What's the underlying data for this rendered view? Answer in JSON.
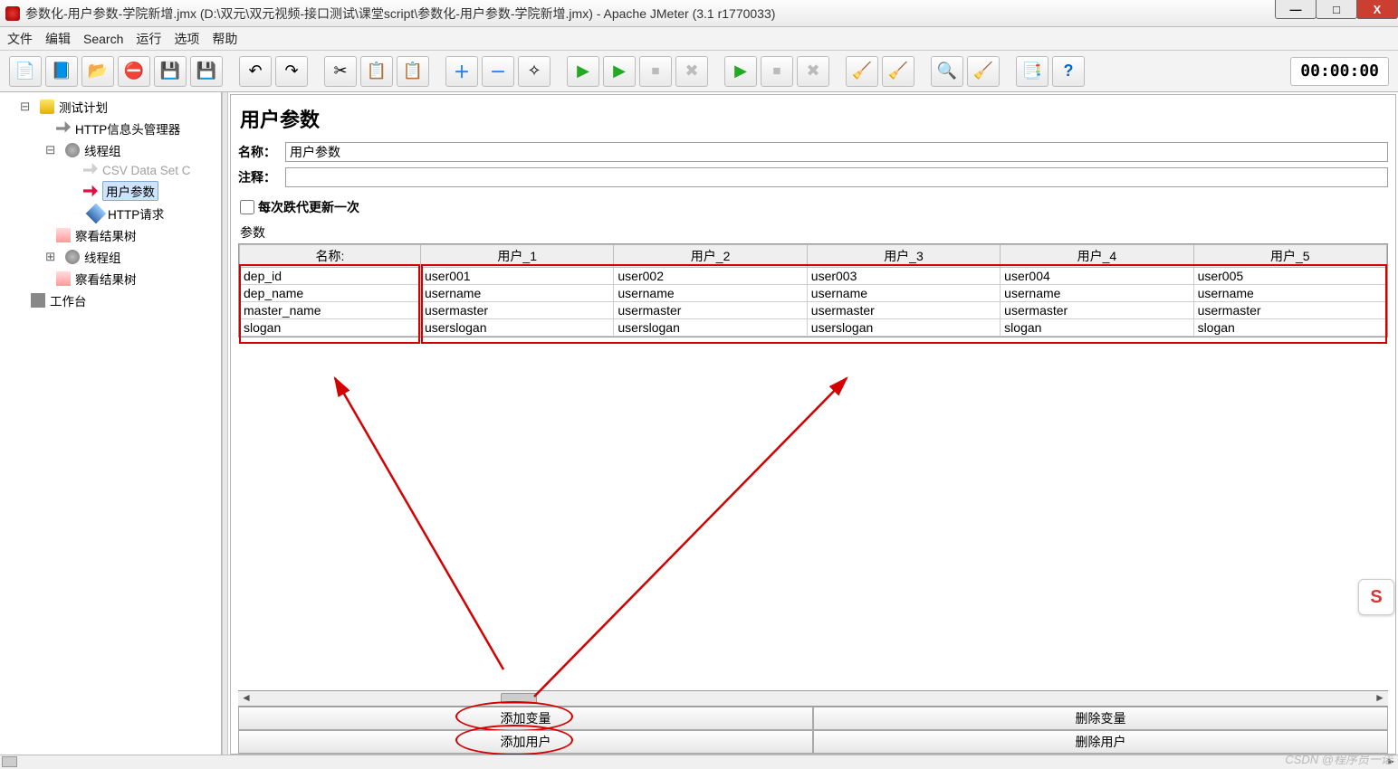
{
  "window": {
    "title": "参数化-用户参数-学院新增.jmx (D:\\双元\\双元视频-接口测试\\课堂script\\参数化-用户参数-学院新增.jmx) - Apache JMeter (3.1 r1770033)",
    "min": "—",
    "max": "□",
    "close": "X"
  },
  "menu": {
    "file": "文件",
    "edit": "编辑",
    "search": "Search",
    "run": "运行",
    "options": "选项",
    "help": "帮助"
  },
  "timer": "00:00:00",
  "tree": {
    "plan": "测试计划",
    "header_mgr": "HTTP信息头管理器",
    "tg1": "线程组",
    "csv": "CSV Data Set C",
    "user_params": "用户参数",
    "http_req": "HTTP请求",
    "results1": "察看结果树",
    "tg2": "线程组",
    "results2": "察看结果树",
    "workbench": "工作台"
  },
  "panel": {
    "title": "用户参数",
    "name_lbl": "名称：",
    "name_val": "用户参数",
    "comment_lbl": "注释：",
    "comment_val": "",
    "chk_lbl": "每次跌代更新一次",
    "params_lbl": "参数",
    "headers": [
      "名称:",
      "用户_1",
      "用户_2",
      "用户_3",
      "用户_4",
      "用户_5"
    ],
    "rows": [
      [
        "dep_id",
        "user001",
        "user002",
        "user003",
        "user004",
        "user005"
      ],
      [
        "dep_name",
        "username",
        "username",
        "username",
        "username",
        "username"
      ],
      [
        "master_name",
        "usermaster",
        "usermaster",
        "usermaster",
        "usermaster",
        "usermaster"
      ],
      [
        "slogan",
        "userslogan",
        "userslogan",
        "userslogan",
        "slogan",
        "slogan"
      ]
    ],
    "btn_add_var": "添加变量",
    "btn_del_var": "删除变量",
    "btn_add_user": "添加用户",
    "btn_del_user": "删除用户"
  },
  "watermark": "CSDN @程序员一诺",
  "sidebox": "S"
}
